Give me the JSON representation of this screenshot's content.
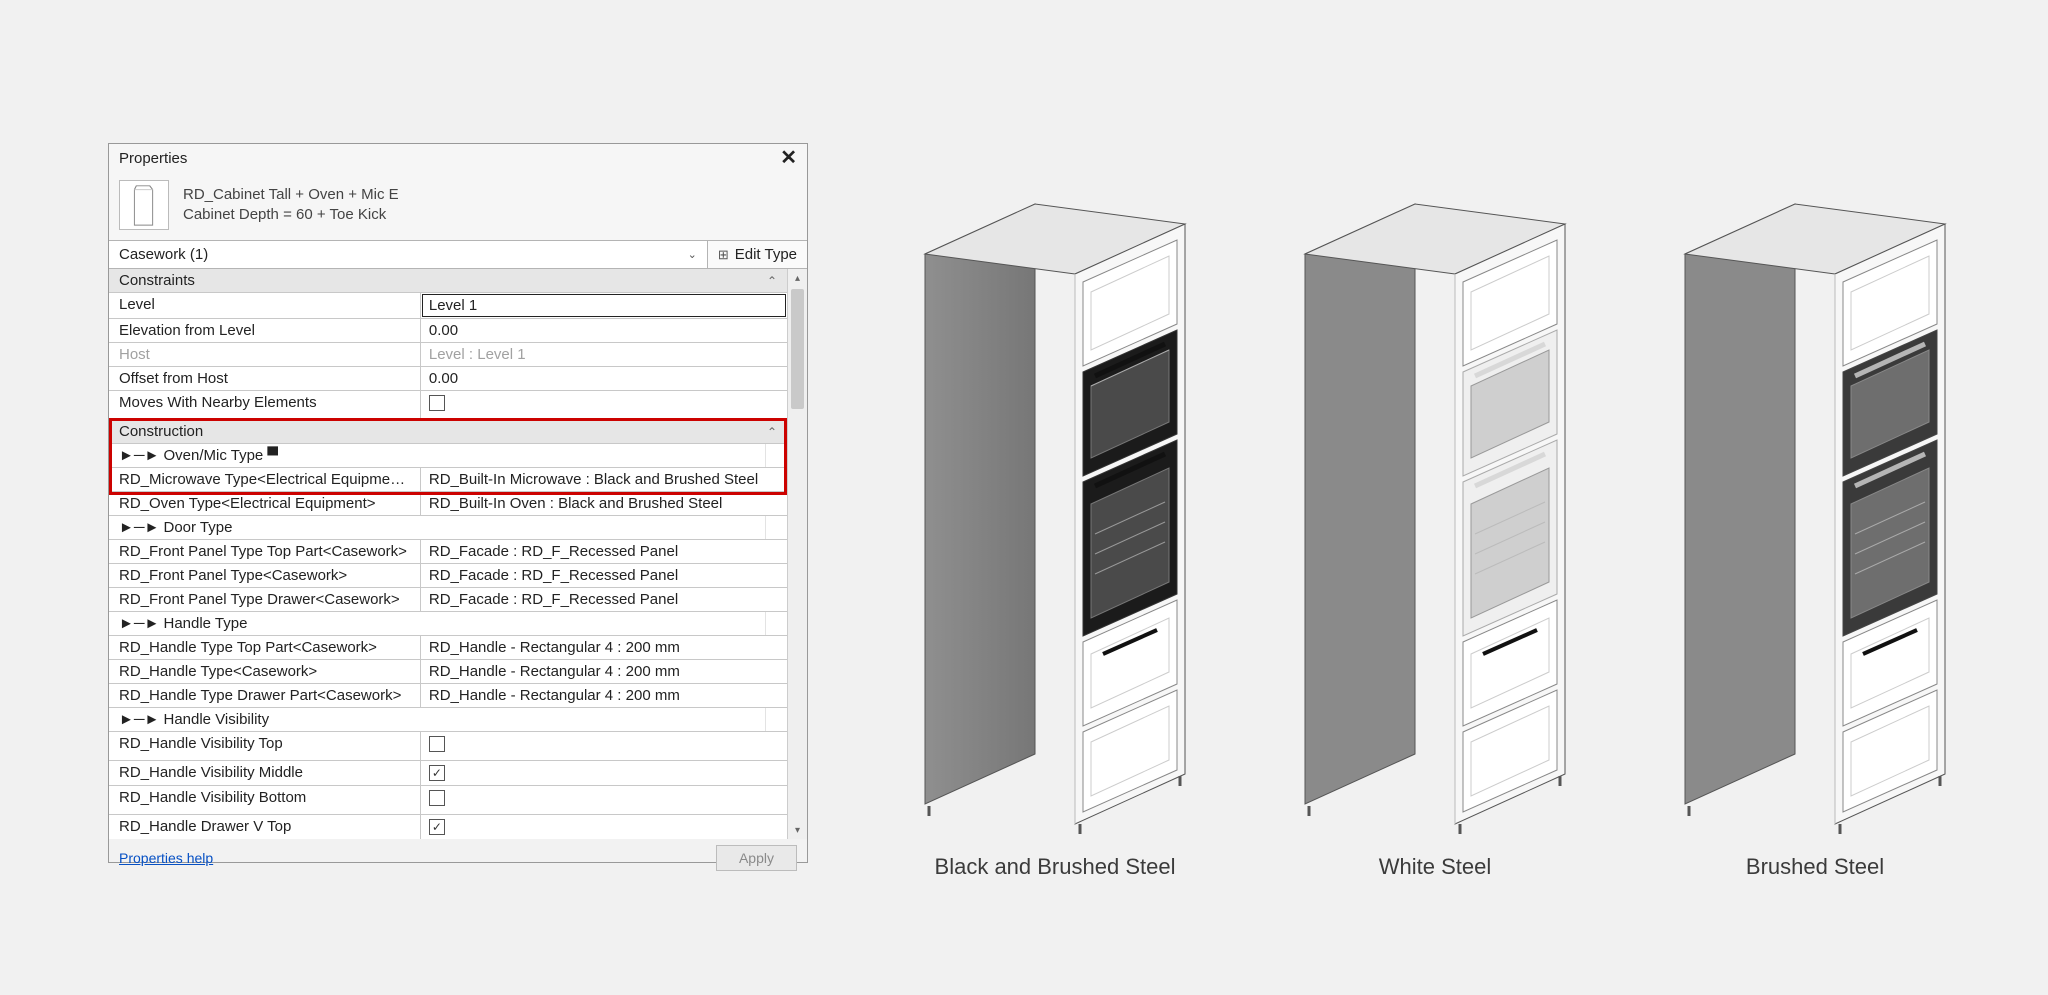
{
  "panel": {
    "title": "Properties",
    "type_name": "RD_Cabinet Tall + Oven + Mic E",
    "type_subline": "Cabinet Depth = 60 + Toe Kick",
    "selector": "Casework (1)",
    "edit_type": "Edit Type"
  },
  "groups": {
    "constraints": "Constraints",
    "construction": "Construction"
  },
  "constraints": [
    {
      "label": "Level",
      "value": "Level 1",
      "input": true
    },
    {
      "label": "Elevation from Level",
      "value": "0.00"
    },
    {
      "label": "Host",
      "value": "Level : Level 1",
      "disabled": true
    },
    {
      "label": "Offset from Host",
      "value": "0.00"
    },
    {
      "label": "Moves With Nearby Elements",
      "checkbox": true,
      "checked": false
    }
  ],
  "construction": [
    {
      "label": "►─► Oven/Mic Type ▀",
      "subheader": true
    },
    {
      "label": "RD_Microwave Type<Electrical Equipment>",
      "value": "RD_Built-In Microwave : Black and Brushed Steel"
    },
    {
      "label": "RD_Oven Type<Electrical Equipment>",
      "value": "RD_Built-In Oven : Black and Brushed Steel"
    },
    {
      "label": "►─► Door Type",
      "subheader": true
    },
    {
      "label": "RD_Front Panel Type Top Part<Casework>",
      "value": "RD_Facade : RD_F_Recessed Panel"
    },
    {
      "label": "RD_Front Panel Type<Casework>",
      "value": "RD_Facade : RD_F_Recessed Panel"
    },
    {
      "label": "RD_Front Panel Type Drawer<Casework>",
      "value": "RD_Facade : RD_F_Recessed Panel"
    },
    {
      "label": "►─► Handle Type",
      "subheader": true
    },
    {
      "label": "RD_Handle Type Top Part<Casework>",
      "value": "RD_Handle - Rectangular 4 : 200 mm"
    },
    {
      "label": "RD_Handle Type<Casework>",
      "value": "RD_Handle - Rectangular 4 : 200 mm"
    },
    {
      "label": "RD_Handle Type Drawer Part<Casework>",
      "value": "RD_Handle - Rectangular 4 : 200 mm"
    },
    {
      "label": "►─► Handle Visibility",
      "subheader": true
    },
    {
      "label": "RD_Handle Visibility Top",
      "checkbox": true,
      "checked": false
    },
    {
      "label": "RD_Handle Visibility Middle",
      "checkbox": true,
      "checked": true
    },
    {
      "label": "RD_Handle Visibility Bottom",
      "checkbox": true,
      "checked": false
    },
    {
      "label": "RD_Handle Drawer V Top",
      "checkbox": true,
      "checked": true
    }
  ],
  "footer": {
    "help": "Properties help",
    "apply": "Apply"
  },
  "captions": {
    "cab1": "Black and Brushed Steel",
    "cab2": "White Steel",
    "cab3": "Brushed Steel"
  }
}
